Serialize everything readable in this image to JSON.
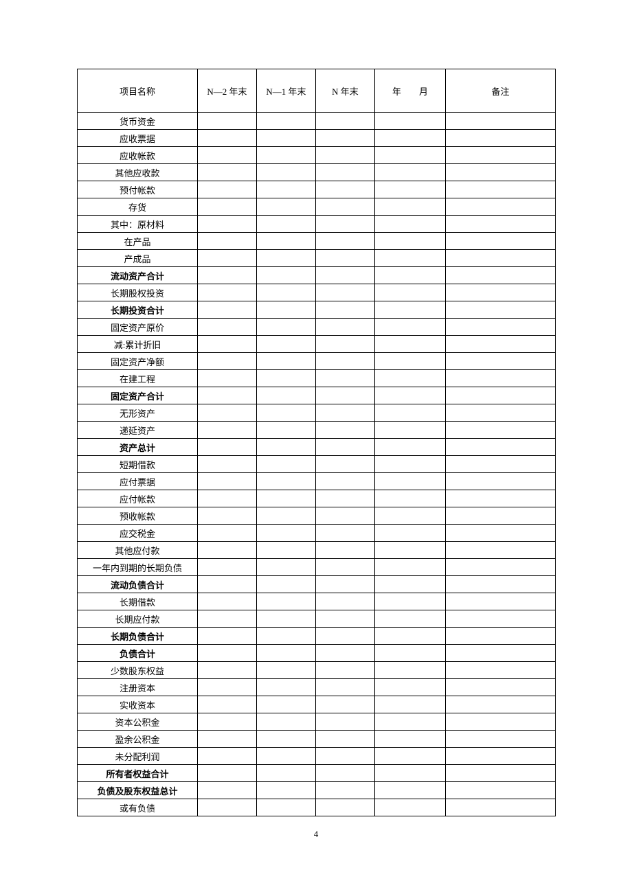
{
  "headers": {
    "name": "项目名称",
    "n2": "N—2 年末",
    "n1": "N—1 年末",
    "n": "N 年末",
    "ym": "年　　月",
    "note": "备注"
  },
  "rows": [
    {
      "label": "货币资金",
      "bold": false
    },
    {
      "label": "应收票据",
      "bold": false
    },
    {
      "label": "应收帐款",
      "bold": false
    },
    {
      "label": "其他应收款",
      "bold": false
    },
    {
      "label": "预付帐款",
      "bold": false
    },
    {
      "label": "存货",
      "bold": false
    },
    {
      "label": "其中：原材料",
      "bold": false
    },
    {
      "label": "在产品",
      "bold": false
    },
    {
      "label": "产成品",
      "bold": false
    },
    {
      "label": "流动资产合计",
      "bold": true
    },
    {
      "label": "长期股权投资",
      "bold": false
    },
    {
      "label": "长期投资合计",
      "bold": true
    },
    {
      "label": "固定资产原价",
      "bold": false
    },
    {
      "label": "减:累计折旧",
      "bold": false
    },
    {
      "label": "固定资产净额",
      "bold": false
    },
    {
      "label": "在建工程",
      "bold": false
    },
    {
      "label": "固定资产合计",
      "bold": true
    },
    {
      "label": "无形资产",
      "bold": false
    },
    {
      "label": "递延资产",
      "bold": false
    },
    {
      "label": "资产总计",
      "bold": true
    },
    {
      "label": "短期借款",
      "bold": false
    },
    {
      "label": "应付票据",
      "bold": false
    },
    {
      "label": "应付帐款",
      "bold": false
    },
    {
      "label": "预收帐款",
      "bold": false
    },
    {
      "label": "应交税金",
      "bold": false
    },
    {
      "label": "其他应付款",
      "bold": false
    },
    {
      "label": "一年内到期的长期负债",
      "bold": false
    },
    {
      "label": "流动负债合计",
      "bold": true
    },
    {
      "label": "长期借款",
      "bold": false
    },
    {
      "label": "长期应付款",
      "bold": false
    },
    {
      "label": "长期负债合计",
      "bold": true
    },
    {
      "label": "负债合计",
      "bold": true
    },
    {
      "label": "少数股东权益",
      "bold": false
    },
    {
      "label": "注册资本",
      "bold": false
    },
    {
      "label": "实收资本",
      "bold": false
    },
    {
      "label": "资本公积金",
      "bold": false
    },
    {
      "label": "盈余公积金",
      "bold": false
    },
    {
      "label": "未分配利润",
      "bold": false
    },
    {
      "label": "所有者权益合计",
      "bold": true
    },
    {
      "label": "负债及股东权益总计",
      "bold": true
    },
    {
      "label": "或有负债",
      "bold": false
    }
  ],
  "page_number": "4"
}
